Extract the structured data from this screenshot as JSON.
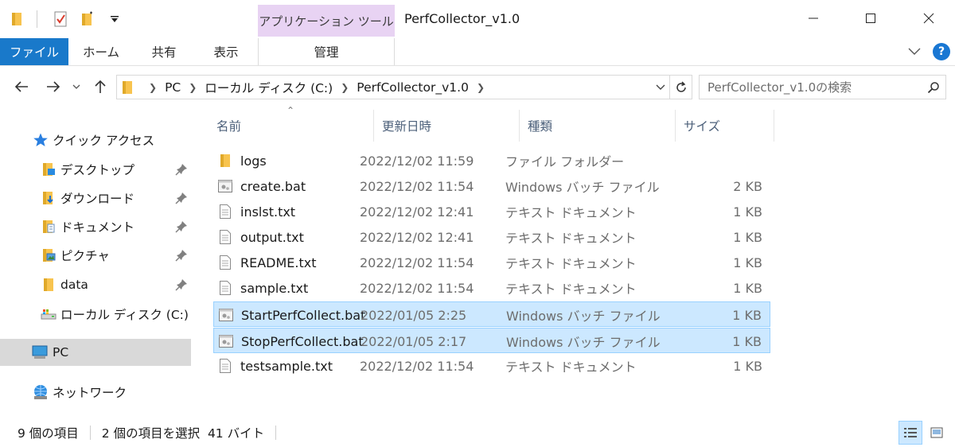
{
  "titlebar": {
    "context_tab": "アプリケーション ツール",
    "window_title": "PerfCollector_v1.0",
    "qat_items": [
      "folder-icon",
      "properties-icon",
      "new-folder-icon",
      "customize-dropdown-icon"
    ]
  },
  "ribbon": {
    "tabs": [
      "ファイル",
      "ホーム",
      "共有",
      "表示"
    ],
    "manage_tab": "管理"
  },
  "address": {
    "crumbs": [
      "PC",
      "ローカル ディスク (C:)",
      "PerfCollector_v1.0"
    ],
    "search_placeholder": "PerfCollector_v1.0の検索"
  },
  "navpane": {
    "items": [
      {
        "label": "クイック アクセス",
        "icon": "star-icon"
      },
      {
        "label": "デスクトップ",
        "icon": "desktop-folder-icon",
        "pinned": true
      },
      {
        "label": "ダウンロード",
        "icon": "downloads-folder-icon",
        "pinned": true
      },
      {
        "label": "ドキュメント",
        "icon": "documents-folder-icon",
        "pinned": true
      },
      {
        "label": "ピクチャ",
        "icon": "pictures-folder-icon",
        "pinned": true
      },
      {
        "label": "data",
        "icon": "folder-icon",
        "pinned": true
      },
      {
        "label": "ローカル ディスク (C:)",
        "icon": "drive-icon"
      },
      {
        "label": "PC",
        "icon": "pc-icon",
        "selected": true
      },
      {
        "label": "ネットワーク",
        "icon": "network-icon"
      }
    ]
  },
  "columns": [
    "名前",
    "更新日時",
    "種類",
    "サイズ"
  ],
  "files": [
    {
      "name": "logs",
      "date": "2022/12/02 11:59",
      "type": "ファイル フォルダー",
      "size": "",
      "icon": "folder-icon"
    },
    {
      "name": "create.bat",
      "date": "2022/12/02 11:54",
      "type": "Windows バッチ ファイル",
      "size": "2 KB",
      "icon": "batch-file-icon"
    },
    {
      "name": "inslst.txt",
      "date": "2022/12/02 12:41",
      "type": "テキスト ドキュメント",
      "size": "1 KB",
      "icon": "text-file-icon"
    },
    {
      "name": "output.txt",
      "date": "2022/12/02 12:41",
      "type": "テキスト ドキュメント",
      "size": "1 KB",
      "icon": "text-file-icon"
    },
    {
      "name": "README.txt",
      "date": "2022/12/02 11:54",
      "type": "テキスト ドキュメント",
      "size": "1 KB",
      "icon": "text-file-icon"
    },
    {
      "name": "sample.txt",
      "date": "2022/12/02 11:54",
      "type": "テキスト ドキュメント",
      "size": "1 KB",
      "icon": "text-file-icon"
    },
    {
      "name": "StartPerfCollect.bat",
      "date": "2022/01/05 2:25",
      "type": "Windows バッチ ファイル",
      "size": "1 KB",
      "icon": "batch-file-icon",
      "selected": true
    },
    {
      "name": "StopPerfCollect.bat",
      "date": "2022/01/05 2:17",
      "type": "Windows バッチ ファイル",
      "size": "1 KB",
      "icon": "batch-file-icon",
      "selected": true
    },
    {
      "name": "testsample.txt",
      "date": "2022/12/02 11:54",
      "type": "テキスト ドキュメント",
      "size": "1 KB",
      "icon": "text-file-icon"
    }
  ],
  "status": {
    "item_count": "9 個の項目",
    "selection": "2 個の項目を選択  41 バイト"
  },
  "colors": {
    "file_tab": "#1979ca",
    "context_tab": "#e8d3f3",
    "selection_bg": "#cce8ff",
    "selection_border": "#99d1ff",
    "folder": "#f8c44f"
  }
}
